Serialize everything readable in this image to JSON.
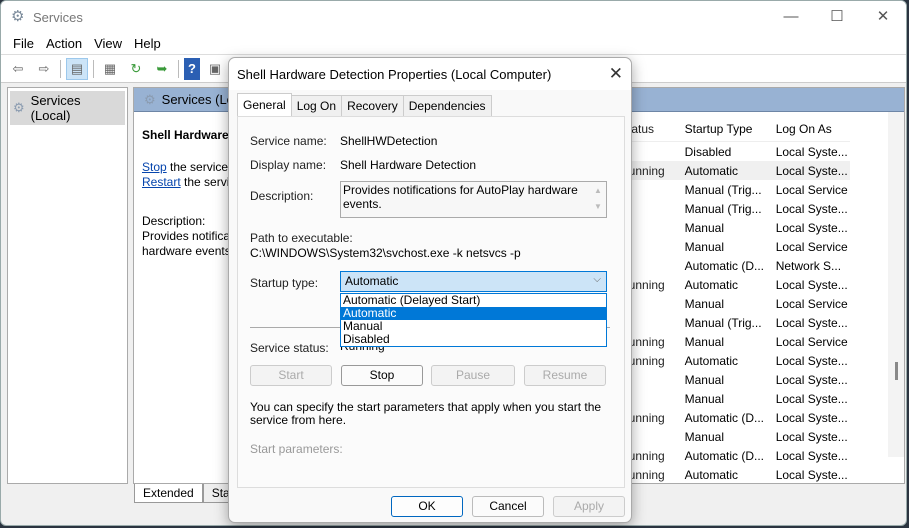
{
  "window": {
    "title": "Services",
    "controls": {
      "minimize": "—",
      "maximize": "☐",
      "close": "✕"
    }
  },
  "menu": [
    "File",
    "Action",
    "View",
    "Help"
  ],
  "toolbar_icons": [
    "back-arrow-icon",
    "forward-arrow-icon",
    "show-hide-tree-icon",
    "properties-icon",
    "refresh-icon",
    "export-list-icon",
    "help-icon",
    "console-icon"
  ],
  "tree": {
    "root": "Services (Local)"
  },
  "right": {
    "header": "Services (Local)",
    "extended": {
      "title": "Shell Hardware Detection",
      "stop_link": "Stop",
      "stop_rest": " the service",
      "restart_link": "Restart",
      "restart_rest": " the service",
      "desc_label": "Description:",
      "desc_line1": "Provides notifications for AutoPlay",
      "desc_line2": "hardware events."
    },
    "columns": [
      "Status",
      "Startup Type",
      "Log On As"
    ],
    "rows": [
      {
        "status": "",
        "startup": "Disabled",
        "logon": "Local Syste..."
      },
      {
        "status": "Running",
        "startup": "Automatic",
        "logon": "Local Syste..."
      },
      {
        "status": "",
        "startup": "Manual (Trig...",
        "logon": "Local Service"
      },
      {
        "status": "",
        "startup": "Manual (Trig...",
        "logon": "Local Syste..."
      },
      {
        "status": "",
        "startup": "Manual",
        "logon": "Local Syste..."
      },
      {
        "status": "",
        "startup": "Manual",
        "logon": "Local Service"
      },
      {
        "status": "",
        "startup": "Automatic (D...",
        "logon": "Network S..."
      },
      {
        "status": "Running",
        "startup": "Automatic",
        "logon": "Local Syste..."
      },
      {
        "status": "",
        "startup": "Manual",
        "logon": "Local Service"
      },
      {
        "status": "",
        "startup": "Manual (Trig...",
        "logon": "Local Syste..."
      },
      {
        "status": "Running",
        "startup": "Manual",
        "logon": "Local Service"
      },
      {
        "status": "Running",
        "startup": "Automatic",
        "logon": "Local Syste..."
      },
      {
        "status": "",
        "startup": "Manual",
        "logon": "Local Syste..."
      },
      {
        "status": "",
        "startup": "Manual",
        "logon": "Local Syste..."
      },
      {
        "status": "Running",
        "startup": "Automatic (D...",
        "logon": "Local Syste..."
      },
      {
        "status": "",
        "startup": "Manual",
        "logon": "Local Syste..."
      },
      {
        "status": "Running",
        "startup": "Automatic (D...",
        "logon": "Local Syste..."
      },
      {
        "status": "Running",
        "startup": "Automatic",
        "logon": "Local Syste..."
      }
    ],
    "bottom_tabs": [
      "Extended",
      "Standard"
    ]
  },
  "dialog": {
    "title": "Shell Hardware Detection Properties (Local Computer)",
    "tabs": [
      "General",
      "Log On",
      "Recovery",
      "Dependencies"
    ],
    "service_name_label": "Service name:",
    "service_name": "ShellHWDetection",
    "display_name_label": "Display name:",
    "display_name": "Shell Hardware Detection",
    "description_label": "Description:",
    "description": "Provides notifications for AutoPlay hardware events.",
    "path_label": "Path to executable:",
    "path": "C:\\WINDOWS\\System32\\svchost.exe -k netsvcs -p",
    "startup_label": "Startup type:",
    "startup_value": "Automatic",
    "startup_options": [
      "Automatic (Delayed Start)",
      "Automatic",
      "Manual",
      "Disabled"
    ],
    "status_label": "Service status:",
    "status_value": "Running",
    "buttons": {
      "start": "Start",
      "stop": "Stop",
      "pause": "Pause",
      "resume": "Resume"
    },
    "info": "You can specify the start parameters that apply when you start the service from here.",
    "start_params_label": "Start parameters:",
    "footer": {
      "ok": "OK",
      "cancel": "Cancel",
      "apply": "Apply"
    }
  }
}
